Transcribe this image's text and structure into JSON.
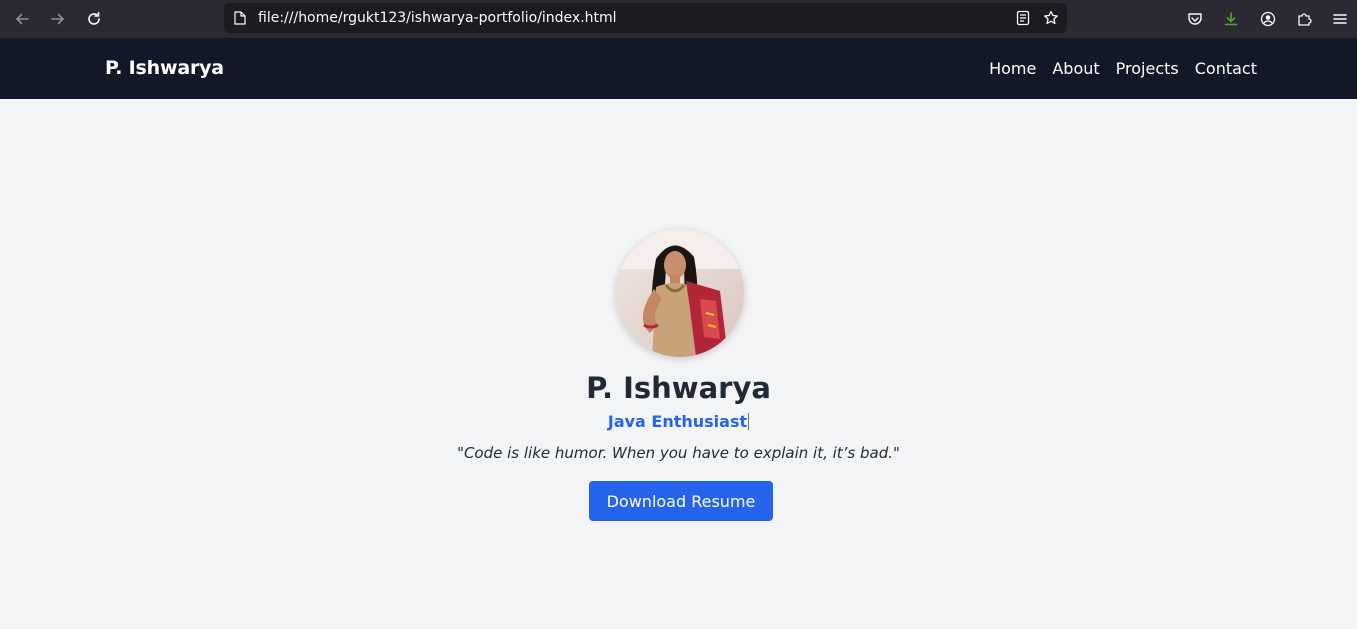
{
  "browser": {
    "url": "file:///home/rgukt123/ishwarya-portfolio/index.html",
    "icons": [
      "back-icon",
      "forward-icon",
      "reload-icon",
      "page-icon",
      "reader-view-icon",
      "bookmark-star-icon",
      "pocket-icon",
      "download-icon",
      "account-icon",
      "extensions-icon",
      "menu-icon"
    ]
  },
  "header": {
    "brand": "P. Ishwarya",
    "nav": [
      "Home",
      "About",
      "Projects",
      "Contact"
    ]
  },
  "hero": {
    "avatar_alt": "P. Ishwarya",
    "name": "P. Ishwarya",
    "role": "Java Enthusiast",
    "quote": "\"Code is like humor. When you have to explain it, it’s bad.\"",
    "cta_label": "Download Resume"
  },
  "colors": {
    "header_bg": "#111827",
    "accent": "#2563eb",
    "page_bg": "#f3f4f6",
    "text_dark": "#1f2937"
  }
}
